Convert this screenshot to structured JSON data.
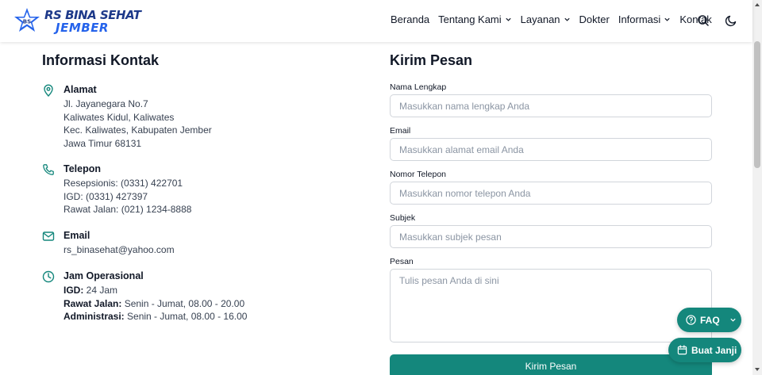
{
  "header": {
    "logo": {
      "line1": "RS BINA SEHAT",
      "line2": "JEMBER",
      "badge": "BS"
    },
    "nav": [
      {
        "label": "Beranda",
        "dropdown": false
      },
      {
        "label": "Tentang Kami",
        "dropdown": true
      },
      {
        "label": "Layanan",
        "dropdown": true
      },
      {
        "label": "Dokter",
        "dropdown": false
      },
      {
        "label": "Informasi",
        "dropdown": true
      },
      {
        "label": "Kontak",
        "dropdown": false
      }
    ],
    "icons": {
      "search": "search-icon",
      "theme": "moon-icon"
    }
  },
  "contact": {
    "title": "Informasi Kontak",
    "address": {
      "label": "Alamat",
      "lines": [
        "Jl. Jayanegara No.7",
        "Kaliwates Kidul, Kaliwates",
        "Kec. Kaliwates, Kabupaten Jember",
        "Jawa Timur 68131"
      ]
    },
    "phone": {
      "label": "Telepon",
      "lines": [
        "Resepsionis: (0331) 422701",
        "IGD: (0331) 427397",
        "Rawat Jalan: (021) 1234-8888"
      ]
    },
    "email": {
      "label": "Email",
      "value": "rs_binasehat@yahoo.com"
    },
    "hours": {
      "label": "Jam Operasional",
      "items": [
        {
          "k": "IGD:",
          "v": " 24 Jam"
        },
        {
          "k": "Rawat Jalan:",
          "v": " Senin - Jumat, 08.00 - 20.00"
        },
        {
          "k": "Administrasi:",
          "v": " Senin - Jumat, 08.00 - 16.00"
        }
      ]
    }
  },
  "form": {
    "title": "Kirim Pesan",
    "name": {
      "label": "Nama Lengkap",
      "placeholder": "Masukkan nama lengkap Anda",
      "value": ""
    },
    "email": {
      "label": "Email",
      "placeholder": "Masukkan alamat email Anda",
      "value": ""
    },
    "phone": {
      "label": "Nomor Telepon",
      "placeholder": "Masukkan nomor telepon Anda",
      "value": ""
    },
    "subject": {
      "label": "Subjek",
      "placeholder": "Masukkan subjek pesan",
      "value": ""
    },
    "message": {
      "label": "Pesan",
      "placeholder": "Tulis pesan Anda di sini",
      "value": ""
    },
    "submit": "Kirim Pesan"
  },
  "floating": {
    "faq": "FAQ",
    "appointment": "Buat Janji"
  },
  "colors": {
    "primary": "#14877c",
    "brand_dark": "#1e3a8a",
    "brand_light": "#2563eb"
  }
}
